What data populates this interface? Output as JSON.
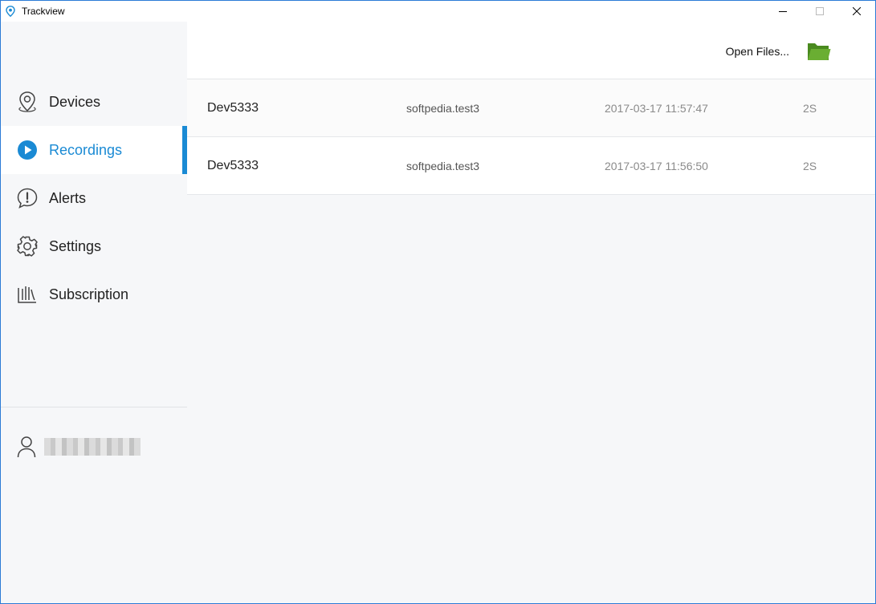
{
  "window": {
    "title": "Trackview",
    "controls": [
      "minimize-icon",
      "maximize-icon",
      "close-icon"
    ]
  },
  "sidebar": {
    "items": [
      {
        "label": "Devices",
        "icon": "location-pin-icon",
        "active": false
      },
      {
        "label": "Recordings",
        "icon": "play-circle-icon",
        "active": true
      },
      {
        "label": "Alerts",
        "icon": "alert-bubble-icon",
        "active": false
      },
      {
        "label": "Settings",
        "icon": "gear-icon",
        "active": false
      },
      {
        "label": "Subscription",
        "icon": "subscription-icon",
        "active": false
      }
    ],
    "user": {
      "icon": "user-icon"
    }
  },
  "toolbar": {
    "open_files_label": "Open Files...",
    "open_files_icon": "folder-icon"
  },
  "recordings": [
    {
      "device": "Dev5333",
      "account": "softpedia.test3",
      "timestamp": "2017-03-17 11:57:47",
      "duration": "2S"
    },
    {
      "device": "Dev5333",
      "account": "softpedia.test3",
      "timestamp": "2017-03-17 11:56:50",
      "duration": "2S"
    }
  ],
  "colors": {
    "accent": "#1a8ad4",
    "folder": "#5a9a2a",
    "sidebar_bg": "#f6f7f9"
  }
}
